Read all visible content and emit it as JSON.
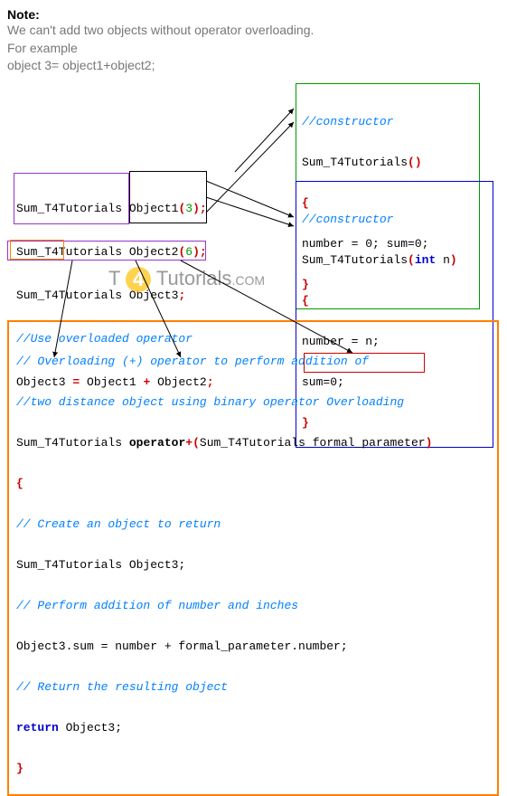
{
  "note": {
    "title": "Note:",
    "line1": "We can't add two objects without operator overloading.",
    "line2": "For example",
    "line3": "object 3= object1+object2;"
  },
  "decl": {
    "type": "Sum_T4Tutorials",
    "o1": "Object1",
    "o2": "Object2",
    "o3": "Object3",
    "arg1": "3",
    "arg2": "6",
    "use_comment": "//Use overloaded operator",
    "assign_lhs": "Object3",
    "assign_r1": "Object1",
    "assign_r2": "Object2"
  },
  "ctor1": {
    "comment": "//constructor",
    "name": "Sum_T4Tutorials",
    "body": "number = 0; sum=0;"
  },
  "ctor2": {
    "comment": "//constructor",
    "name": "Sum_T4Tutorials",
    "param_type": "int",
    "param_name": "n",
    "body1": "number = n;",
    "body2": "sum=0;"
  },
  "overload": {
    "c1": "// Overloading (+) operator to perform addition of",
    "c2": "//two distance object using binary operator Overloading",
    "ret_type": "Sum_T4Tutorials",
    "op_kw": "operator",
    "op_sym": "+",
    "param_type": "Sum_T4Tutorials",
    "param_name": "formal_parameter",
    "c3": "// Create an object to return",
    "local_decl": "Sum_T4Tutorials Object3;",
    "c4": "// Perform addition of number and inches",
    "assign": "Object3.sum = number + formal_parameter.number;",
    "c5": "// Return the resulting object",
    "ret_kw": "return",
    "ret_val": "Object3;"
  },
  "watermark": {
    "t": "T",
    "four": "4",
    "rest": "Tutorials",
    "dotcom": ".COM"
  }
}
